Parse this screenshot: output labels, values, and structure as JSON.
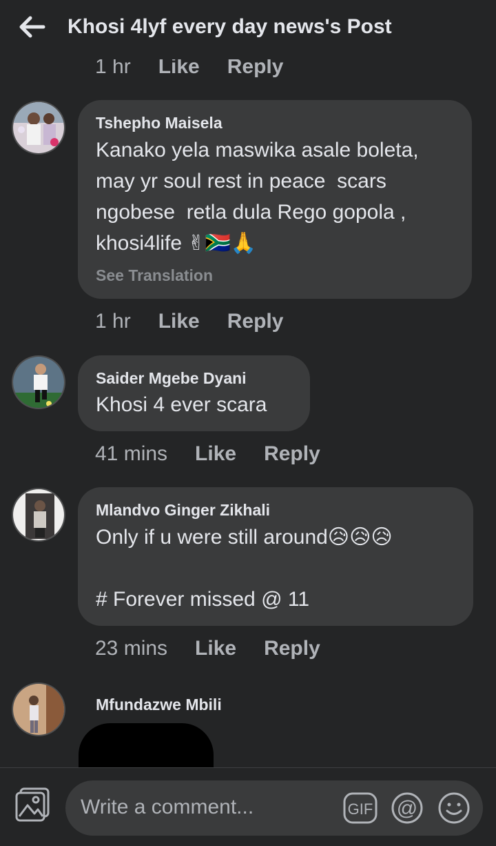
{
  "header": {
    "title": "Khosi 4lyf every day news's Post"
  },
  "previous_comment": {
    "time": "1 hr",
    "like_label": "Like",
    "reply_label": "Reply"
  },
  "comments": [
    {
      "author": "Tshepho Maisela",
      "text": "Kanako yela maswika asale boleta,\nmay yr soul rest in peace  scars\nngobese  retla dula Rego gopola ,\nkhosi4life ✌🇿🇦🙏",
      "see_translation": "See Translation",
      "time": "1 hr",
      "like_label": "Like",
      "reply_label": "Reply"
    },
    {
      "author": "Saider Mgebe Dyani",
      "text": "Khosi 4 ever scara",
      "time": "41 mins",
      "like_label": "Like",
      "reply_label": "Reply"
    },
    {
      "author": "Mlandvo Ginger Zikhali",
      "text": "Only if u were still around😥😥😥\n\n# Forever missed @ 11",
      "time": "23 mins",
      "like_label": "Like",
      "reply_label": "Reply"
    },
    {
      "author": "Mfundazwe Mbili"
    }
  ],
  "composer": {
    "placeholder": "Write a comment..."
  },
  "icons": {
    "back": "back-arrow-icon",
    "photo": "photo-icon",
    "gif": "gif-icon",
    "mention": "at-mention-icon",
    "emoji": "emoji-icon"
  },
  "colors": {
    "background": "#242526",
    "bubble": "#3a3b3c",
    "text": "#e4e6eb",
    "secondary_text": "#b0b3b8"
  }
}
